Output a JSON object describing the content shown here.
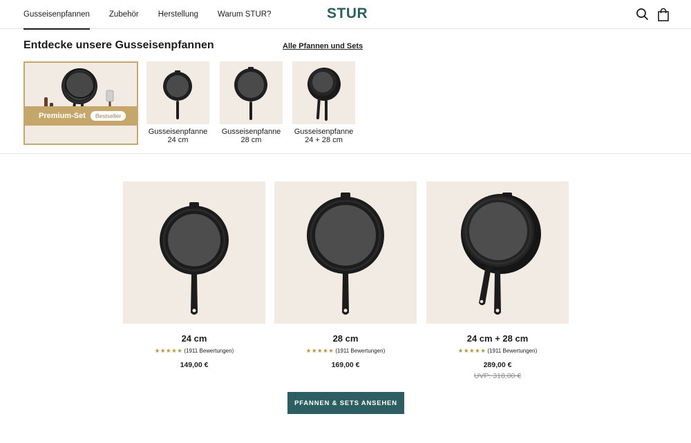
{
  "header": {
    "nav": [
      {
        "label": "Gusseisenpfannen",
        "active": true
      },
      {
        "label": "Zubehör",
        "active": false
      },
      {
        "label": "Herstellung",
        "active": false
      },
      {
        "label": "Warum STUR?",
        "active": false
      }
    ],
    "logo": "STUR",
    "icons": [
      "search-icon",
      "shopping-bag-icon"
    ]
  },
  "categories": {
    "title": "Entdecke unsere Gusseisenpfannen",
    "all_link": "Alle Pfannen und Sets",
    "items": [
      {
        "label": "Premium-Set",
        "badge": "Bestseller"
      },
      {
        "label": "Gusseisenpfanne\n24 cm"
      },
      {
        "label": "Gusseisenpfanne\n28 cm"
      },
      {
        "label": "Gusseisenpfanne\n24 + 28 cm"
      }
    ]
  },
  "products": [
    {
      "title": "24 cm",
      "rating": 4.5,
      "reviews": "(1911 Bewertungen)",
      "price": "149,00 €",
      "uvp": ""
    },
    {
      "title": "28 cm",
      "rating": 4.5,
      "reviews": "(1911 Bewertungen)",
      "price": "169,00 €",
      "uvp": ""
    },
    {
      "title": "24 cm + 28 cm",
      "rating": 4.5,
      "reviews": "(1911 Bewertungen)",
      "price": "289,00 €",
      "uvp": "UVP: 318,00 €"
    }
  ],
  "cta": "PFANNEN & SETS ANSEHEN",
  "colors": {
    "brand": "#2d5e62",
    "accent_gold": "#c5a76b",
    "image_bg": "#f1ebe4",
    "star": "#b8953f"
  }
}
